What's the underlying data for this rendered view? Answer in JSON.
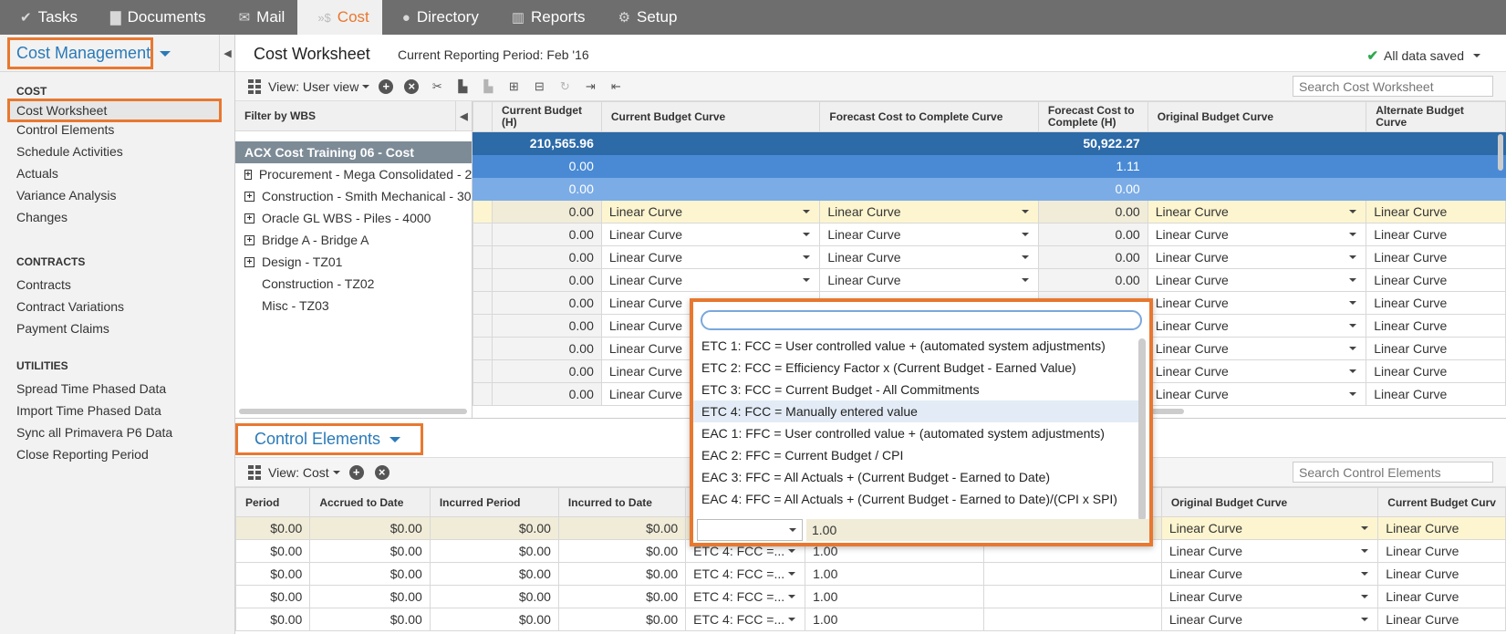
{
  "nav": {
    "tabs": [
      {
        "label": "Tasks",
        "icon": "check-icon"
      },
      {
        "label": "Documents",
        "icon": "document-icon"
      },
      {
        "label": "Mail",
        "icon": "envelope-icon"
      },
      {
        "label": "Cost",
        "icon": "dollar-icon",
        "active": true
      },
      {
        "label": "Directory",
        "icon": "people-icon"
      },
      {
        "label": "Reports",
        "icon": "bar-chart-icon"
      },
      {
        "label": "Setup",
        "icon": "gear-icon"
      }
    ]
  },
  "sidebar": {
    "title": "Cost Management",
    "sections": [
      {
        "heading": "COST",
        "items": [
          "Cost Worksheet",
          "Control Elements",
          "Schedule Activities",
          "Actuals",
          "Variance Analysis",
          "Changes"
        ]
      },
      {
        "heading": "CONTRACTS",
        "items": [
          "Contracts",
          "Contract Variations",
          "Payment Claims"
        ]
      },
      {
        "heading": "UTILITIES",
        "items": [
          "Spread Time Phased Data",
          "Import Time Phased Data",
          "Sync all Primavera P6 Data",
          "Close Reporting Period"
        ]
      }
    ],
    "active_item": "Cost Worksheet"
  },
  "header": {
    "title": "Cost Worksheet",
    "period": "Current Reporting Period: Feb '16",
    "saved": "All data saved"
  },
  "toolbar": {
    "view": "View: User view",
    "search_placeholder": "Search Cost Worksheet"
  },
  "wbs": {
    "filter_label": "Filter by WBS",
    "root": "ACX Cost Training 06 - Cost",
    "items": [
      {
        "label": "Procurement - Mega Consolidated - 2",
        "expandable": true
      },
      {
        "label": "Construction - Smith Mechanical - 30",
        "expandable": true
      },
      {
        "label": "Oracle GL WBS - Piles - 4000",
        "expandable": true
      },
      {
        "label": "Bridge A - Bridge A",
        "expandable": true
      },
      {
        "label": "Design - TZ01",
        "expandable": true
      },
      {
        "label": "Construction - TZ02",
        "expandable": false
      },
      {
        "label": "Misc - TZ03",
        "expandable": false
      }
    ]
  },
  "cost_grid": {
    "columns": [
      "Current Budget (H)",
      "Current Budget Curve",
      "Forecast Cost to Complete Curve",
      "Forecast Cost to Complete (H)",
      "Original Budget Curve",
      "Alternate Budget Curve"
    ],
    "summary_rows": [
      {
        "budget": "210,565.96",
        "forecast": "50,922.27"
      },
      {
        "budget": "0.00",
        "forecast": "1.11"
      },
      {
        "budget": "0.00",
        "forecast": "0.00"
      }
    ],
    "rows": [
      {
        "budget": "0.00",
        "cb_curve": "Linear Curve",
        "fc_curve": "Linear Curve",
        "forecast": "0.00",
        "ob_curve": "Linear Curve",
        "ab_curve": "Linear Curve"
      },
      {
        "budget": "0.00",
        "cb_curve": "Linear Curve",
        "fc_curve": "Linear Curve",
        "forecast": "0.00",
        "ob_curve": "Linear Curve",
        "ab_curve": "Linear Curve"
      },
      {
        "budget": "0.00",
        "cb_curve": "Linear Curve",
        "fc_curve": "Linear Curve",
        "forecast": "0.00",
        "ob_curve": "Linear Curve",
        "ab_curve": "Linear Curve"
      },
      {
        "budget": "0.00",
        "cb_curve": "Linear Curve",
        "fc_curve": "Linear Curve",
        "forecast": "0.00",
        "ob_curve": "Linear Curve",
        "ab_curve": "Linear Curve"
      },
      {
        "budget": "0.00",
        "cb_curve": "Linear Curve",
        "fc_curve": "Linear Curve",
        "forecast": "0.00",
        "ob_curve": "Linear Curve",
        "ab_curve": "Linear Curve"
      },
      {
        "budget": "0.00",
        "cb_curve": "Linear Curve",
        "fc_curve": "",
        "forecast": "",
        "ob_curve": "Linear Curve",
        "ab_curve": "Linear Curve"
      },
      {
        "budget": "0.00",
        "cb_curve": "Linear Curve",
        "fc_curve": "",
        "forecast": "",
        "ob_curve": "Linear Curve",
        "ab_curve": "Linear Curve"
      },
      {
        "budget": "0.00",
        "cb_curve": "Linear Curve",
        "fc_curve": "",
        "forecast": "",
        "ob_curve": "Linear Curve",
        "ab_curve": "Linear Curve"
      },
      {
        "budget": "0.00",
        "cb_curve": "Linear Curve",
        "fc_curve": "",
        "forecast": "",
        "ob_curve": "Linear Curve",
        "ab_curve": "Linear Curve"
      }
    ]
  },
  "control_elements": {
    "title": "Control Elements",
    "view": "View: Cost",
    "search_placeholder": "Search Control Elements",
    "columns": [
      "Period",
      "Accrued to Date",
      "Incurred Period",
      "Incurred to Date",
      "",
      "",
      "",
      "Original Budget Curve",
      "Current Budget Curv"
    ],
    "rows": [
      {
        "period": "$0.00",
        "accrued": "$0.00",
        "inc_period": "$0.00",
        "inc_date": "$0.00",
        "method": "",
        "factor": "1.00",
        "ob_curve": "Linear Curve",
        "cb_curve": "Linear Curve"
      },
      {
        "period": "$0.00",
        "accrued": "$0.00",
        "inc_period": "$0.00",
        "inc_date": "$0.00",
        "method": "ETC 4: FCC =...",
        "factor": "1.00",
        "ob_curve": "Linear Curve",
        "cb_curve": "Linear Curve"
      },
      {
        "period": "$0.00",
        "accrued": "$0.00",
        "inc_period": "$0.00",
        "inc_date": "$0.00",
        "method": "ETC 4: FCC =...",
        "factor": "1.00",
        "ob_curve": "Linear Curve",
        "cb_curve": "Linear Curve"
      },
      {
        "period": "$0.00",
        "accrued": "$0.00",
        "inc_period": "$0.00",
        "inc_date": "$0.00",
        "method": "ETC 4: FCC =...",
        "factor": "1.00",
        "ob_curve": "Linear Curve",
        "cb_curve": "Linear Curve"
      },
      {
        "period": "$0.00",
        "accrued": "$0.00",
        "inc_period": "$0.00",
        "inc_date": "$0.00",
        "method": "ETC 4: FCC =...",
        "factor": "1.00",
        "ob_curve": "Linear Curve",
        "cb_curve": "Linear Curve"
      }
    ]
  },
  "dropdown": {
    "search_value": "",
    "options": [
      "ETC 1: FCC = User controlled value + (automated system adjustments)",
      "ETC 2: FCC = Efficiency Factor x (Current Budget - Earned Value)",
      "ETC 3: FCC = Current Budget - All Commitments",
      "ETC 4: FCC = Manually entered value",
      "EAC 1: FFC = User controlled value + (automated system adjustments)",
      "EAC 2: FFC = Current Budget / CPI",
      "EAC 3: FFC = All Actuals + (Current Budget - Earned to Date)",
      "EAC 4: FFC = All Actuals + (Current Budget - Earned to Date)/(CPI x SPI)"
    ],
    "highlighted_index": 3,
    "cell_value": "1.00"
  },
  "colors": {
    "accent": "#e8782f",
    "link": "#2a7ab8",
    "nav_bg": "#6e6e6e"
  }
}
